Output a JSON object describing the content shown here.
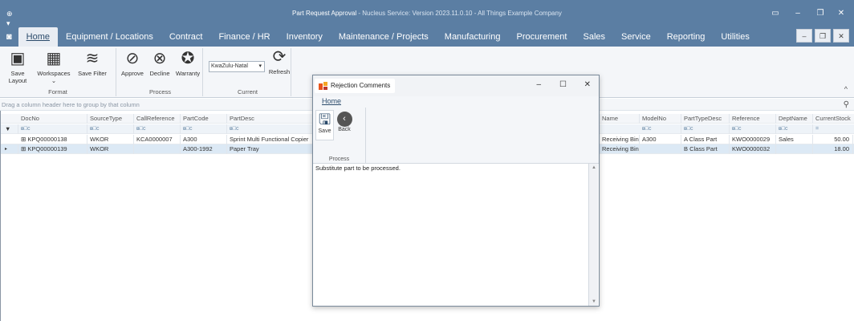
{
  "window": {
    "title_main": "Part Request Approval",
    "title_sub": " - Nucleus Service: Version 2023.11.0.10 - All Things Example Company"
  },
  "menu": [
    "Home",
    "Equipment / Locations",
    "Contract",
    "Finance / HR",
    "Inventory",
    "Maintenance / Projects",
    "Manufacturing",
    "Procurement",
    "Sales",
    "Service",
    "Reporting",
    "Utilities"
  ],
  "ribbon": {
    "format": {
      "label": "Format",
      "save_layout": "Save Layout",
      "workspaces": "Workspaces",
      "save_filter": "Save Filter"
    },
    "process": {
      "label": "Process",
      "approve": "Approve",
      "decline": "Decline",
      "warranty": "Warranty"
    },
    "current": {
      "label": "Current",
      "region": "KwaZulu-Natal",
      "refresh": "Refresh"
    }
  },
  "groupbar_hint": "Drag a column header here to group by that column",
  "grid": {
    "left_columns": [
      "DocNo",
      "SourceType",
      "CallReference",
      "PartCode",
      "PartDesc"
    ],
    "right_columns": [
      "Name",
      "ModelNo",
      "PartTypeDesc",
      "Reference",
      "DeptName",
      "CurrentStock"
    ],
    "rows": [
      {
        "docno": "KPQ00000138",
        "source": "WKOR",
        "callref": "KCA0000007",
        "partcode": "A300",
        "partdesc": "Sprint Multi Functional Copier",
        "name": "Receiving Bin",
        "model": "A300",
        "ptype": "A Class Part",
        "ref": "KWO0000029",
        "dept": "Sales",
        "stock": "50.00"
      },
      {
        "docno": "KPQ00000139",
        "source": "WKOR",
        "callref": "",
        "partcode": "A300-1992",
        "partdesc": "Paper Tray",
        "name": "Receiving Bin",
        "model": "",
        "ptype": "B Class Part",
        "ref": "KWO0000032",
        "dept": "",
        "stock": "18.00"
      }
    ]
  },
  "dialog": {
    "title": "Rejection Comments",
    "menu_home": "Home",
    "save": "Save",
    "back": "Back",
    "group_label": "Process",
    "comment": "Substitute part to be processed."
  }
}
